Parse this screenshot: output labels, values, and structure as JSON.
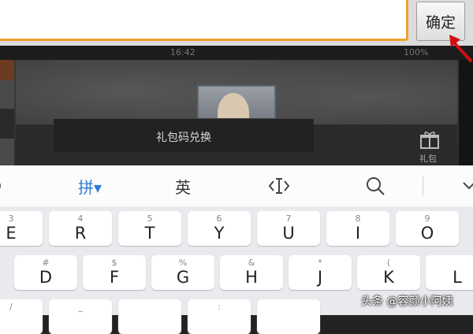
{
  "top": {
    "confirm_label": "确定"
  },
  "status": {
    "time": "16:42",
    "right": "100%"
  },
  "dialog": {
    "title": "礼包码兑换",
    "gift_label": "礼包"
  },
  "toolbar": {
    "pinyin": "拼▾",
    "english": "英",
    "cursor": "‹I›",
    "search": "🔍"
  },
  "keyboard": {
    "row1": [
      {
        "hint": "3",
        "key": "E"
      },
      {
        "hint": "4",
        "key": "R"
      },
      {
        "hint": "5",
        "key": "T"
      },
      {
        "hint": "6",
        "key": "Y"
      },
      {
        "hint": "7",
        "key": "U"
      },
      {
        "hint": "8",
        "key": "I"
      },
      {
        "hint": "9",
        "key": "O"
      }
    ],
    "row2": [
      {
        "hint": "#",
        "key": "D"
      },
      {
        "hint": "$",
        "key": "F"
      },
      {
        "hint": "%",
        "key": "G"
      },
      {
        "hint": "&",
        "key": "H"
      },
      {
        "hint": "*",
        "key": "J"
      },
      {
        "hint": "(",
        "key": "K"
      },
      {
        "hint": "",
        "key": "L"
      }
    ],
    "row3": [
      {
        "hint": "/",
        "key": ""
      },
      {
        "hint": "_",
        "key": ""
      },
      {
        "hint": "",
        "key": ""
      },
      {
        "hint": ":",
        "key": ""
      },
      {
        "hint": "",
        "key": ""
      }
    ]
  },
  "watermark": {
    "text": "头条 @容颜小阿姨"
  },
  "colors": {
    "input_border": "#f0a030",
    "arrow": "#d01010",
    "pinyin_accent": "#2d7cd8"
  }
}
